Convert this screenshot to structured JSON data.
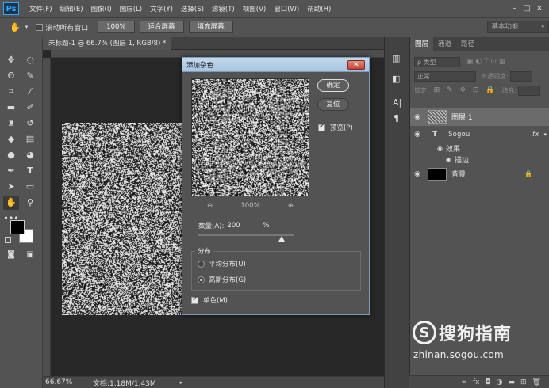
{
  "menubar": {
    "logo": "Ps",
    "items": [
      "文件(F)",
      "编辑(E)",
      "图像(I)",
      "图层(L)",
      "文字(Y)",
      "选择(S)",
      "滤镜(T)",
      "视图(V)",
      "窗口(W)",
      "帮助(H)"
    ],
    "window_controls": [
      "–",
      "□",
      "×"
    ]
  },
  "options_bar": {
    "scroll_all_windows": "滚动所有窗口",
    "zoom_100": "100%",
    "fit_screen": "适合屏幕",
    "fill_screen": "填充屏幕",
    "workspace": "基本功能"
  },
  "document": {
    "tab_title": "未标题-1 @ 66.7% (图层 1, RGB/8) *",
    "tab_close": "×",
    "status_zoom": "66.67%",
    "status_doc": "文档:1.18M/1.43M"
  },
  "layers_panel": {
    "tabs": [
      "图层",
      "通道",
      "路径"
    ],
    "filter_kind": "ρ 类型",
    "blend_mode": "正常",
    "opacity_label": "不透明度:",
    "lock_label": "锁定:",
    "fill_label": "填充:",
    "layers": [
      {
        "name": "图层 1",
        "type": "noise"
      },
      {
        "name": "Sogou",
        "type": "text",
        "fx": "fx"
      },
      {
        "name": "效果",
        "type": "effect"
      },
      {
        "name": "描边",
        "type": "effect-item"
      },
      {
        "name": "背景",
        "type": "background"
      }
    ]
  },
  "dialog": {
    "title": "添加杂色",
    "ok": "确定",
    "reset": "复位",
    "preview_label": "预览(P)",
    "preview_checked": true,
    "zoom_value": "100%",
    "amount_label": "数量(A):",
    "amount_value": "200",
    "amount_unit": "%",
    "amount_slider_fraction": 0.88,
    "distribution_label": "分布",
    "uniform_label": "平均分布(U)",
    "gaussian_label": "高斯分布(G)",
    "gaussian_selected": true,
    "monochrome_label": "单色(M)",
    "monochrome_checked": true
  },
  "watermark": {
    "brand": "搜狗指南",
    "url": "zhinan.sogou.com"
  }
}
